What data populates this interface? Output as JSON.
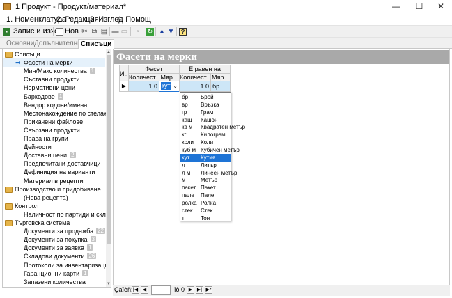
{
  "window": {
    "title": "1 Продукт - Продукт/материал*",
    "min_glyph": "—",
    "max_glyph": "☐",
    "close_glyph": "✕"
  },
  "menu": [
    {
      "label": "1. Номенклатура"
    },
    {
      "label": "2. Редакция"
    },
    {
      "label": "3. Изглед"
    },
    {
      "label": "4. Помощ"
    }
  ],
  "toolbar": {
    "save_exit_label": "Запис и изход",
    "new_label": "Нов"
  },
  "tabs": [
    {
      "label": "Основни"
    },
    {
      "label": "Допълнителни"
    },
    {
      "label": "Списъци"
    }
  ],
  "sidebar": {
    "items": [
      {
        "label": "Списъци",
        "type": "folder"
      },
      {
        "label": "Фасети на мерки",
        "type": "current"
      },
      {
        "label": "Мин/Макс количества",
        "count": "1"
      },
      {
        "label": "Съставни продукти"
      },
      {
        "label": "Нормативни цени"
      },
      {
        "label": "Баркодове",
        "count": "1"
      },
      {
        "label": "Вендор кодове/имена"
      },
      {
        "label": "Местонахождение по стелажи"
      },
      {
        "label": "Прикачени файлове"
      },
      {
        "label": "Свързани продукти"
      },
      {
        "label": "Права на групи"
      },
      {
        "label": "Дейности"
      },
      {
        "label": "Доставни цени",
        "count": "2"
      },
      {
        "label": "Предпочитани доставчици"
      },
      {
        "label": "Дефиниция на варианти"
      },
      {
        "label": "Материал в рецепти"
      },
      {
        "label": "Производство и придобиване",
        "type": "folder"
      },
      {
        "label": "(Нова рецепта)"
      },
      {
        "label": "Контрол",
        "type": "folder"
      },
      {
        "label": "Наличност по партиди и склад"
      },
      {
        "label": "Търговска система",
        "type": "folder"
      },
      {
        "label": "Документи за продажба",
        "count": "22"
      },
      {
        "label": "Документи за покупка",
        "count": "3"
      },
      {
        "label": "Документи за заявка",
        "count": "1"
      },
      {
        "label": "Складови документи",
        "count": "26"
      },
      {
        "label": "Протоколи за инвентаризация"
      },
      {
        "label": "Гаранционни карти",
        "count": "1"
      },
      {
        "label": "Запазени количества"
      }
    ]
  },
  "content": {
    "title": "Фасети на мерки",
    "grid": {
      "row_header": "И...",
      "groups": [
        "Фасет",
        "Е равен на"
      ],
      "columns": [
        "Количест...",
        "Мяр...",
        "Количест...",
        "Мяр..."
      ],
      "row": {
        "qty1": "1.0",
        "unit1": "кут",
        "qty2": "1.0",
        "unit2": "бр"
      }
    },
    "dropdown": [
      {
        "code": "бр",
        "name": "Брой"
      },
      {
        "code": "вр",
        "name": "Връзка"
      },
      {
        "code": "гр",
        "name": "Грам"
      },
      {
        "code": "каш",
        "name": "Кашон"
      },
      {
        "code": "кв м",
        "name": "Квадратен метър"
      },
      {
        "code": "кг",
        "name": "Килограм"
      },
      {
        "code": "коли",
        "name": "Коли"
      },
      {
        "code": "куб м",
        "name": "Кубичен метър"
      },
      {
        "code": "кут",
        "name": "Кутия",
        "selected": true
      },
      {
        "code": "л",
        "name": "Литър"
      },
      {
        "code": "л м",
        "name": "Линеен метър"
      },
      {
        "code": "м",
        "name": "Метър"
      },
      {
        "code": "пакет",
        "name": "Пакет"
      },
      {
        "code": "пале",
        "name": "Пале"
      },
      {
        "code": "ролка",
        "name": "Ролка"
      },
      {
        "code": "стек",
        "name": "Стек"
      },
      {
        "code": "т",
        "name": "Тон"
      }
    ]
  },
  "status": {
    "record_label": "Çàïèñ:",
    "of_label": "îò 0"
  }
}
